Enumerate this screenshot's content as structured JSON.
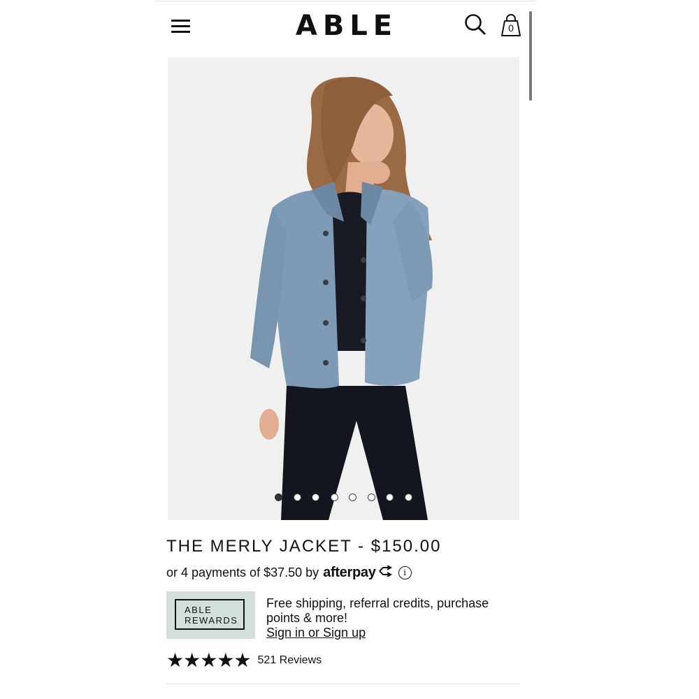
{
  "header": {
    "logo": "ABLE",
    "bag_count": "0",
    "icons": {
      "menu": "hamburger-menu-icon",
      "search": "search-icon",
      "bag": "shopping-bag-icon"
    }
  },
  "gallery": {
    "image_description": "model-wearing-denim-jacket",
    "dot_count": 8,
    "active_index": 0
  },
  "product": {
    "title": "THE MERLY JACKET - $150.00",
    "installment_text": "or 4 payments of $37.50 by",
    "afterpay_brand": "afterpay",
    "info_symbol": "i"
  },
  "rewards": {
    "badge_line1": "ABLE",
    "badge_line2": "REWARDS",
    "promo_text": "Free shipping, referral credits, purchase points & more!",
    "signin_link": "Sign in or Sign up",
    "badge_color": "#d3dfdd"
  },
  "reviews": {
    "stars": "★★★★★",
    "rating": 5,
    "count_label": "521 Reviews"
  }
}
